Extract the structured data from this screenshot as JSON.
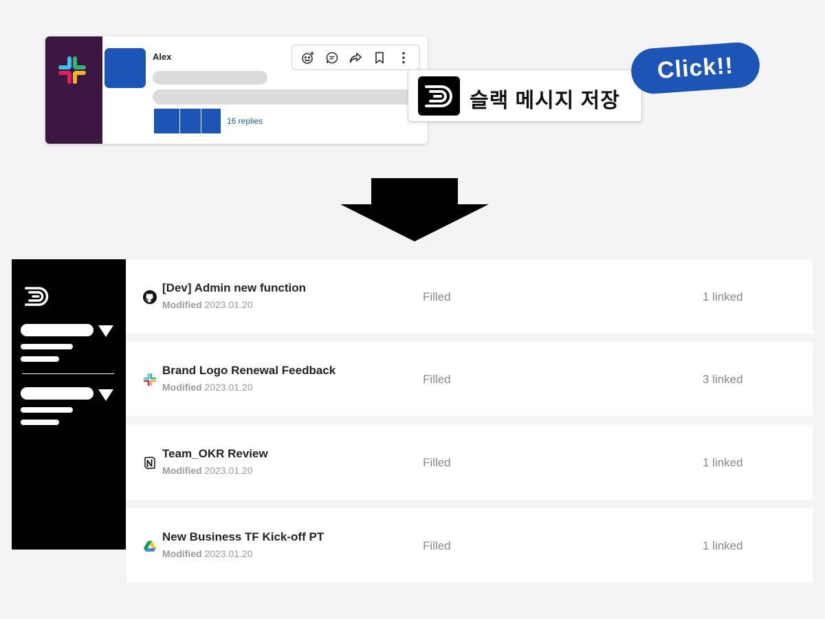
{
  "slack_message": {
    "author": "Alex",
    "replies": "16 replies",
    "toolbar": {
      "icons": [
        "add-reaction-icon",
        "reply-in-thread-icon",
        "share-icon",
        "bookmark-icon",
        "more-icon"
      ]
    }
  },
  "save_popup": {
    "label": "슬랙 메시지 저장"
  },
  "click_badge": {
    "text": "Click!!"
  },
  "colors": {
    "accent_blue": "#1c55b6",
    "slack_sidebar": "#3a1640",
    "app_sidebar": "#000000",
    "link_blue": "#1264a3"
  },
  "documents": [
    {
      "icon": "github-icon",
      "title": "[Dev] Admin new function",
      "modified_label": "Modified",
      "modified_date": "2023.01.20",
      "status": "Filled",
      "linked": "1 linked"
    },
    {
      "icon": "slack-icon",
      "title": "Brand Logo Renewal Feedback",
      "modified_label": "Modified",
      "modified_date": "2023.01.20",
      "status": "Filled",
      "linked": "3 linked"
    },
    {
      "icon": "notion-icon",
      "title": "Team_OKR Review",
      "modified_label": "Modified",
      "modified_date": "2023.01.20",
      "status": "Filled",
      "linked": "1 linked"
    },
    {
      "icon": "google-drive-icon",
      "title": "New Business TF Kick-off PT",
      "modified_label": "Modified",
      "modified_date": "2023.01.20",
      "status": "Filled",
      "linked": "1 linked"
    }
  ]
}
